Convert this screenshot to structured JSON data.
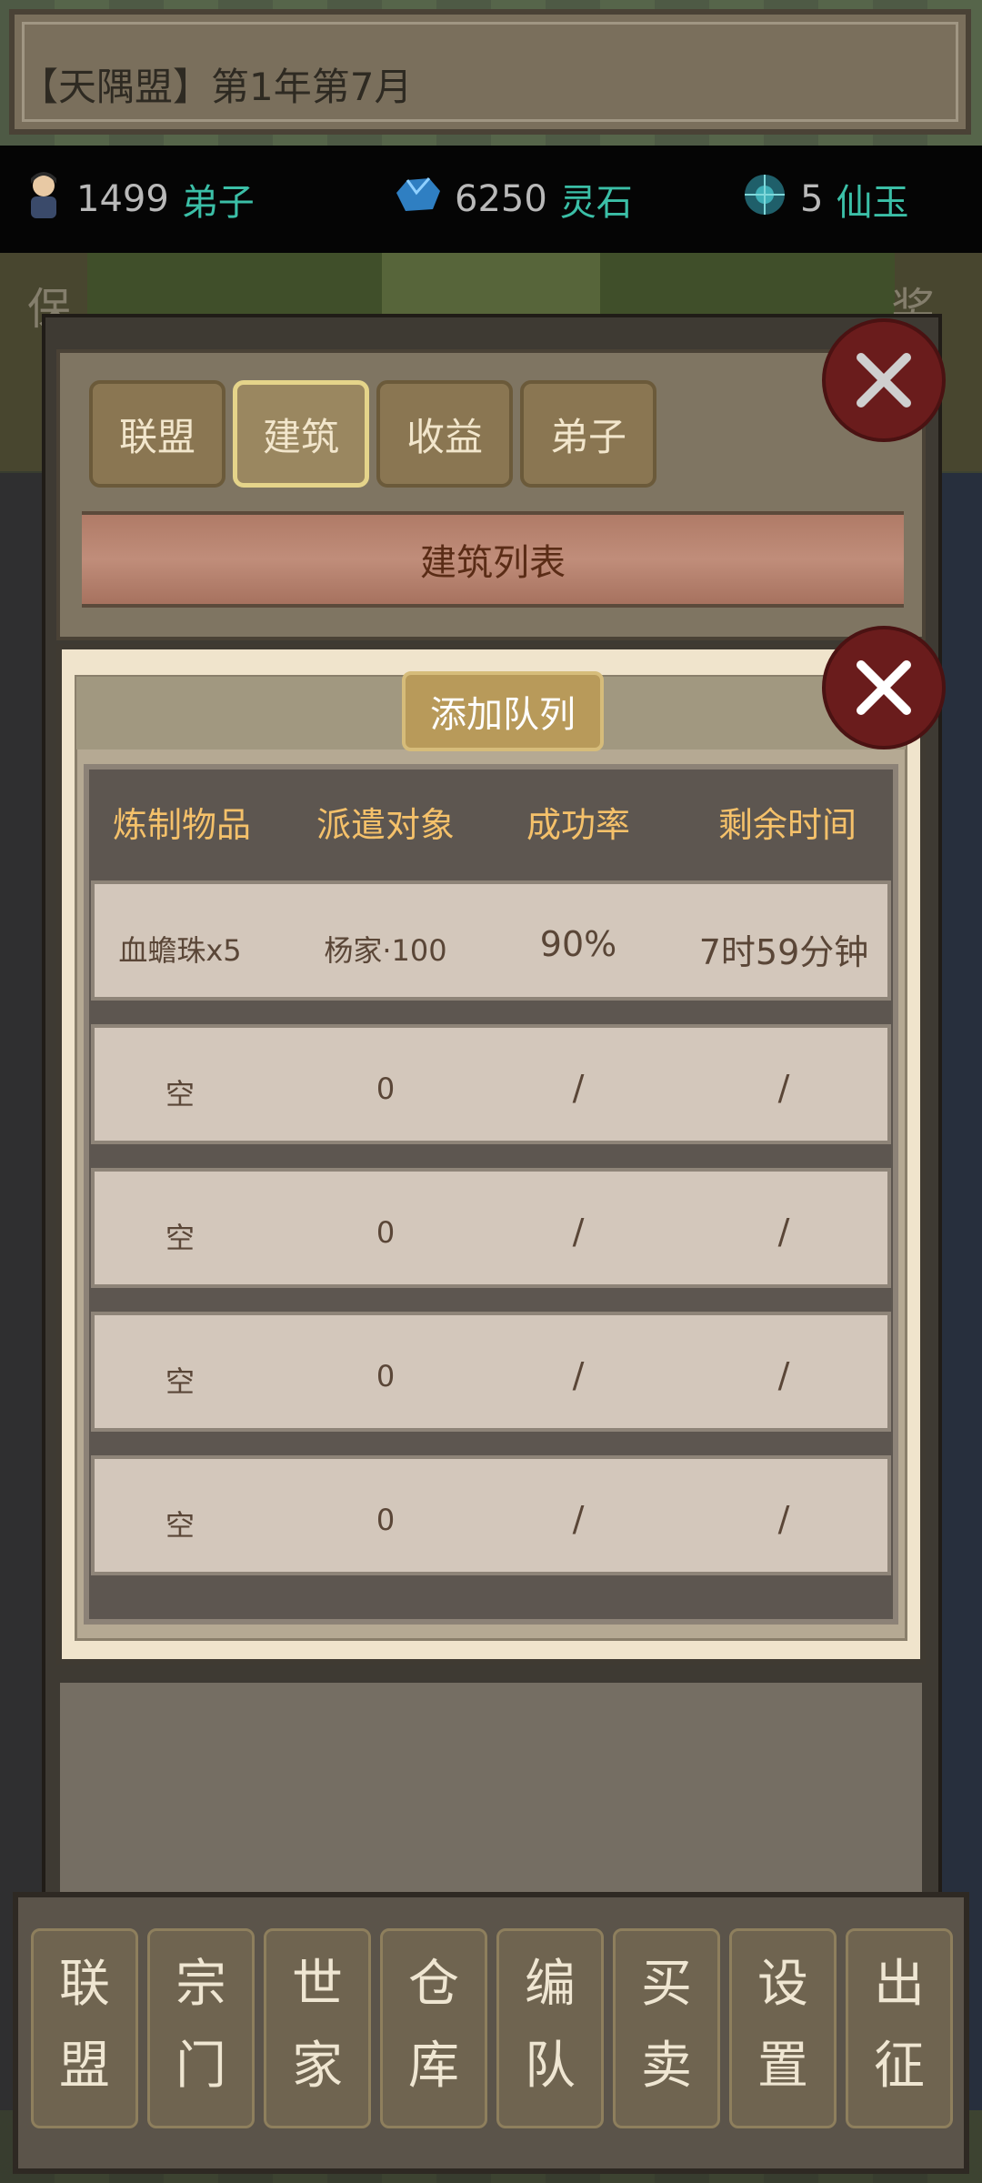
{
  "header": {
    "title": "【天隅盟】第1年第7月"
  },
  "resources": [
    {
      "icon": "disciple-avatar-icon",
      "value": "1499",
      "unit": "弟子"
    },
    {
      "icon": "spirit-stone-icon",
      "value": "6250",
      "unit": "灵石"
    },
    {
      "icon": "immortal-jade-icon",
      "value": "5",
      "unit": "仙玉"
    }
  ],
  "side_hints": {
    "left": "保",
    "right": "奖"
  },
  "tabs": [
    {
      "label": "联盟",
      "active": false
    },
    {
      "label": "建筑",
      "active": true
    },
    {
      "label": "收益",
      "active": false
    },
    {
      "label": "弟子",
      "active": false
    }
  ],
  "building_list": {
    "label": "建筑列表"
  },
  "queue_dialog": {
    "add_button": "添加队列",
    "columns": [
      "炼制物品",
      "派遣对象",
      "成功率",
      "剩余时间"
    ],
    "rows": [
      [
        "血蟾珠x5",
        "杨家·100",
        "90%",
        "7时59分钟"
      ],
      [
        "空",
        "0",
        "/",
        "/"
      ],
      [
        "空",
        "0",
        "/",
        "/"
      ],
      [
        "空",
        "0",
        "/",
        "/"
      ],
      [
        "空",
        "0",
        "/",
        "/"
      ]
    ]
  },
  "bottom_nav": [
    {
      "top": "联",
      "bottom": "盟"
    },
    {
      "top": "宗",
      "bottom": "门"
    },
    {
      "top": "世",
      "bottom": "家"
    },
    {
      "top": "仓",
      "bottom": "库"
    },
    {
      "top": "编",
      "bottom": "队"
    },
    {
      "top": "买",
      "bottom": "卖"
    },
    {
      "top": "设",
      "bottom": "置"
    },
    {
      "top": "出",
      "bottom": "征"
    }
  ],
  "colors": {
    "resource_unit": "#3bbfa7",
    "table_header": "#f5c16a",
    "close_button": "#6a1c1c"
  }
}
